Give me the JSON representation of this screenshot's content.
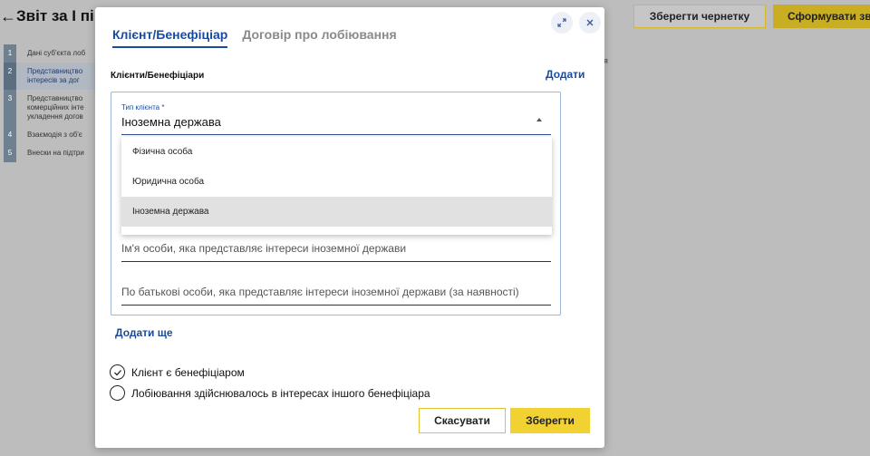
{
  "background": {
    "back_arrow": "←",
    "title": "Звіт за І пі",
    "draft_button": "Зберегти чернетку",
    "form_button": "Сформувати зві",
    "right_letter": "я",
    "steps": [
      {
        "num": "1",
        "text": "Дані суб'єкта лоб"
      },
      {
        "num": "2",
        "text": "Представництво\nінтересів за дог"
      },
      {
        "num": "3",
        "text": "Представництво\nкомерційних інте\nукладення догов"
      },
      {
        "num": "4",
        "text": "Взаємодія з об'є"
      },
      {
        "num": "5",
        "text": "Внески на підтри"
      }
    ]
  },
  "modal": {
    "tabs": [
      "Клієнт/Бенефіціар",
      "Договір про лобіювання"
    ],
    "expand_icon": "expand-icon",
    "close_icon": "close-icon",
    "section_label": "Клієнти/Бенефіціари",
    "add_label": "Додати",
    "client_type": {
      "label": "Тип клієнта *",
      "value": "Іноземна держава",
      "options": [
        "Фізична особа",
        "Юридична особа",
        "Іноземна держава"
      ],
      "selected_index": 2
    },
    "name_placeholder": "Ім'я особи, яка представляє інтереси іноземної держави",
    "patronymic_placeholder": "По батькові особи, яка представляє інтереси іноземної держави (за наявності)",
    "add_more_label": "Додати ще",
    "radio_options": [
      {
        "label": "Клієнт є бенефіціаром",
        "checked": true
      },
      {
        "label": "Лобіювання здійснювалось в інтересах іншого бенефіціара",
        "checked": false
      }
    ],
    "cancel_label": "Скасувати",
    "save_label": "Зберегти"
  },
  "colors": {
    "accent_blue": "#1a4a9c",
    "accent_yellow": "#f2d233",
    "overlay_gray": "#bdbdbd"
  }
}
